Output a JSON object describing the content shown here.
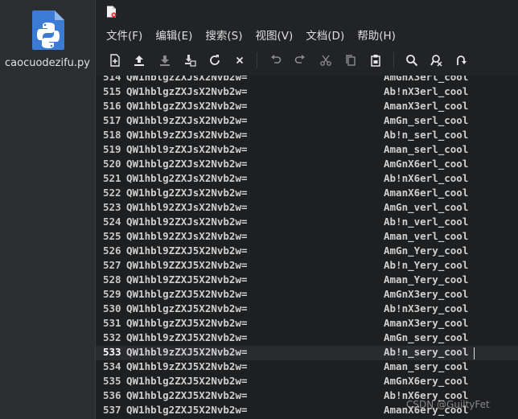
{
  "desktop": {
    "file_label": "caocuodezifu.py",
    "icon": "python-file-icon"
  },
  "window": {
    "icon": "text-document-icon",
    "accent": "#e02424"
  },
  "menu": [
    {
      "label": "文件(F)"
    },
    {
      "label": "编辑(E)"
    },
    {
      "label": "搜索(S)"
    },
    {
      "label": "视图(V)"
    },
    {
      "label": "文档(D)"
    },
    {
      "label": "帮助(H)"
    }
  ],
  "toolbar": [
    {
      "name": "new-file-button",
      "icon": "new-file-icon"
    },
    {
      "name": "open-file-button",
      "icon": "open-file-icon"
    },
    {
      "name": "save-button",
      "icon": "save-icon"
    },
    {
      "name": "save-as-button",
      "icon": "save-as-icon"
    },
    {
      "name": "reload-button",
      "icon": "reload-icon"
    },
    {
      "name": "close-button",
      "icon": "close-icon"
    },
    {
      "name": "undo-button",
      "icon": "undo-icon"
    },
    {
      "name": "redo-button",
      "icon": "redo-icon"
    },
    {
      "name": "cut-button",
      "icon": "cut-icon"
    },
    {
      "name": "copy-button",
      "icon": "copy-icon"
    },
    {
      "name": "paste-button",
      "icon": "paste-icon"
    },
    {
      "name": "search-button",
      "icon": "search-icon"
    },
    {
      "name": "replace-button",
      "icon": "replace-icon"
    },
    {
      "name": "goto-button",
      "icon": "goto-icon"
    }
  ],
  "editor": {
    "current_line": "533",
    "lines": [
      {
        "num": "514",
        "encoded": "QW1hblgzZXJsX2Nvb2w=",
        "decoded": "AmGnX3erl_cool"
      },
      {
        "num": "515",
        "encoded": "QW1hblgzZXJsX2Nvb2w=",
        "decoded": "Ab!nX3erl_cool"
      },
      {
        "num": "516",
        "encoded": "QW1hblgzZXJsX2Nvb2w=",
        "decoded": "AmanX3erl_cool"
      },
      {
        "num": "517",
        "encoded": "QW1hbl9zZXJsX2Nvb2w=",
        "decoded": "AmGn_serl_cool"
      },
      {
        "num": "518",
        "encoded": "QW1hbl9zZXJsX2Nvb2w=",
        "decoded": "Ab!n_serl_cool"
      },
      {
        "num": "519",
        "encoded": "QW1hbl9zZXJsX2Nvb2w=",
        "decoded": "Aman_serl_cool"
      },
      {
        "num": "520",
        "encoded": "QW1hblg2ZXJsX2Nvb2w=",
        "decoded": "AmGnX6erl_cool"
      },
      {
        "num": "521",
        "encoded": "QW1hblg2ZXJsX2Nvb2w=",
        "decoded": "Ab!nX6erl_cool"
      },
      {
        "num": "522",
        "encoded": "QW1hblg2ZXJsX2Nvb2w=",
        "decoded": "AmanX6erl_cool"
      },
      {
        "num": "523",
        "encoded": "QW1hbl92ZXJsX2Nvb2w=",
        "decoded": "AmGn_verl_cool"
      },
      {
        "num": "524",
        "encoded": "QW1hbl92ZXJsX2Nvb2w=",
        "decoded": "Ab!n_verl_cool"
      },
      {
        "num": "525",
        "encoded": "QW1hbl92ZXJsX2Nvb2w=",
        "decoded": "Aman_verl_cool"
      },
      {
        "num": "526",
        "encoded": "QW1hbl9ZZXJ5X2Nvb2w=",
        "decoded": "AmGn_Yery_cool"
      },
      {
        "num": "527",
        "encoded": "QW1hbl9ZZXJ5X2Nvb2w=",
        "decoded": "Ab!n_Yery_cool"
      },
      {
        "num": "528",
        "encoded": "QW1hbl9ZZXJ5X2Nvb2w=",
        "decoded": "Aman_Yery_cool"
      },
      {
        "num": "529",
        "encoded": "QW1hblgzZXJ5X2Nvb2w=",
        "decoded": "AmGnX3ery_cool"
      },
      {
        "num": "530",
        "encoded": "QW1hblgzZXJ5X2Nvb2w=",
        "decoded": "Ab!nX3ery_cool"
      },
      {
        "num": "531",
        "encoded": "QW1hblgzZXJ5X2Nvb2w=",
        "decoded": "AmanX3ery_cool"
      },
      {
        "num": "532",
        "encoded": "QW1hbl9zZXJ5X2Nvb2w=",
        "decoded": "AmGn_sery_cool"
      },
      {
        "num": "533",
        "encoded": "QW1hbl9zZXJ5X2Nvb2w=",
        "decoded": "Ab!n_sery_cool"
      },
      {
        "num": "534",
        "encoded": "QW1hbl9zZXJ5X2Nvb2w=",
        "decoded": "Aman_sery_cool"
      },
      {
        "num": "535",
        "encoded": "QW1hblg2ZXJ5X2Nvb2w=",
        "decoded": "AmGnX6ery_cool"
      },
      {
        "num": "536",
        "encoded": "QW1hblg2ZXJ5X2Nvb2w=",
        "decoded": "Ab!nX6ery_cool"
      },
      {
        "num": "537",
        "encoded": "QW1hblg2ZXJ5X2Nvb2w=",
        "decoded": "AmanX6ery_cool"
      }
    ]
  },
  "watermark": "CSDN @GuiltyFet"
}
